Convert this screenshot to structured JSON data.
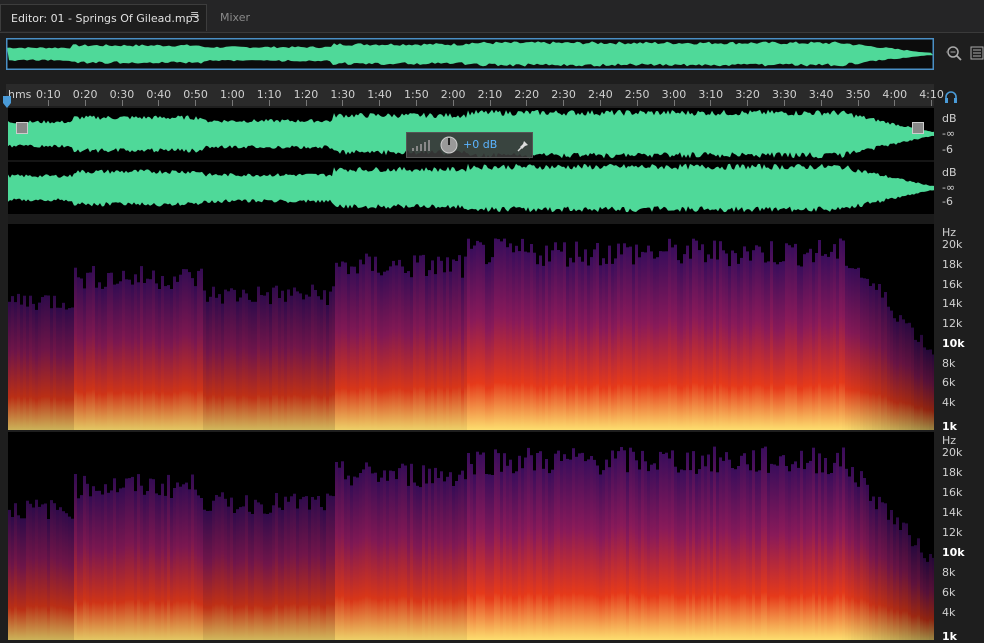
{
  "tabs": {
    "editor_label": "Editor: 01 - Springs Of Gilead.mp3",
    "mixer_label": "Mixer",
    "menu_glyph": "≡"
  },
  "timeline": {
    "unit_label": "hms",
    "labels": [
      "0:10",
      "0:20",
      "0:30",
      "0:40",
      "0:50",
      "1:00",
      "1:10",
      "1:20",
      "1:30",
      "1:40",
      "1:50",
      "2:00",
      "2:10",
      "2:20",
      "2:30",
      "2:40",
      "2:50",
      "3:00",
      "3:10",
      "3:20",
      "3:30",
      "3:40",
      "3:50",
      "4:00",
      "4:10"
    ]
  },
  "hud": {
    "value": "+0 dB"
  },
  "db_scale": {
    "unit": "dB",
    "inf": "-∞",
    "minus6": "-6"
  },
  "hz_scale": {
    "unit": "Hz",
    "labels": [
      "20k",
      "18k",
      "16k",
      "14k",
      "12k",
      "10k",
      "8k",
      "6k",
      "4k",
      "1k"
    ]
  },
  "icons": {
    "zoom": "zoom-in-magnifier-icon",
    "panel": "panel-menu-icon",
    "headphone": "headphone-icon",
    "playhead": "playhead-marker-icon",
    "pin": "pin-icon",
    "knob": "volume-knob-icon",
    "meter": "level-meter-icon"
  },
  "colors": {
    "waveform": "#4fd999",
    "selection_border": "#4a8fc5",
    "hud_text": "#5bb4ff",
    "spectral_low": "#3a0d5c",
    "spectral_mid": "#e83a1a",
    "spectral_high": "#ffe070"
  }
}
